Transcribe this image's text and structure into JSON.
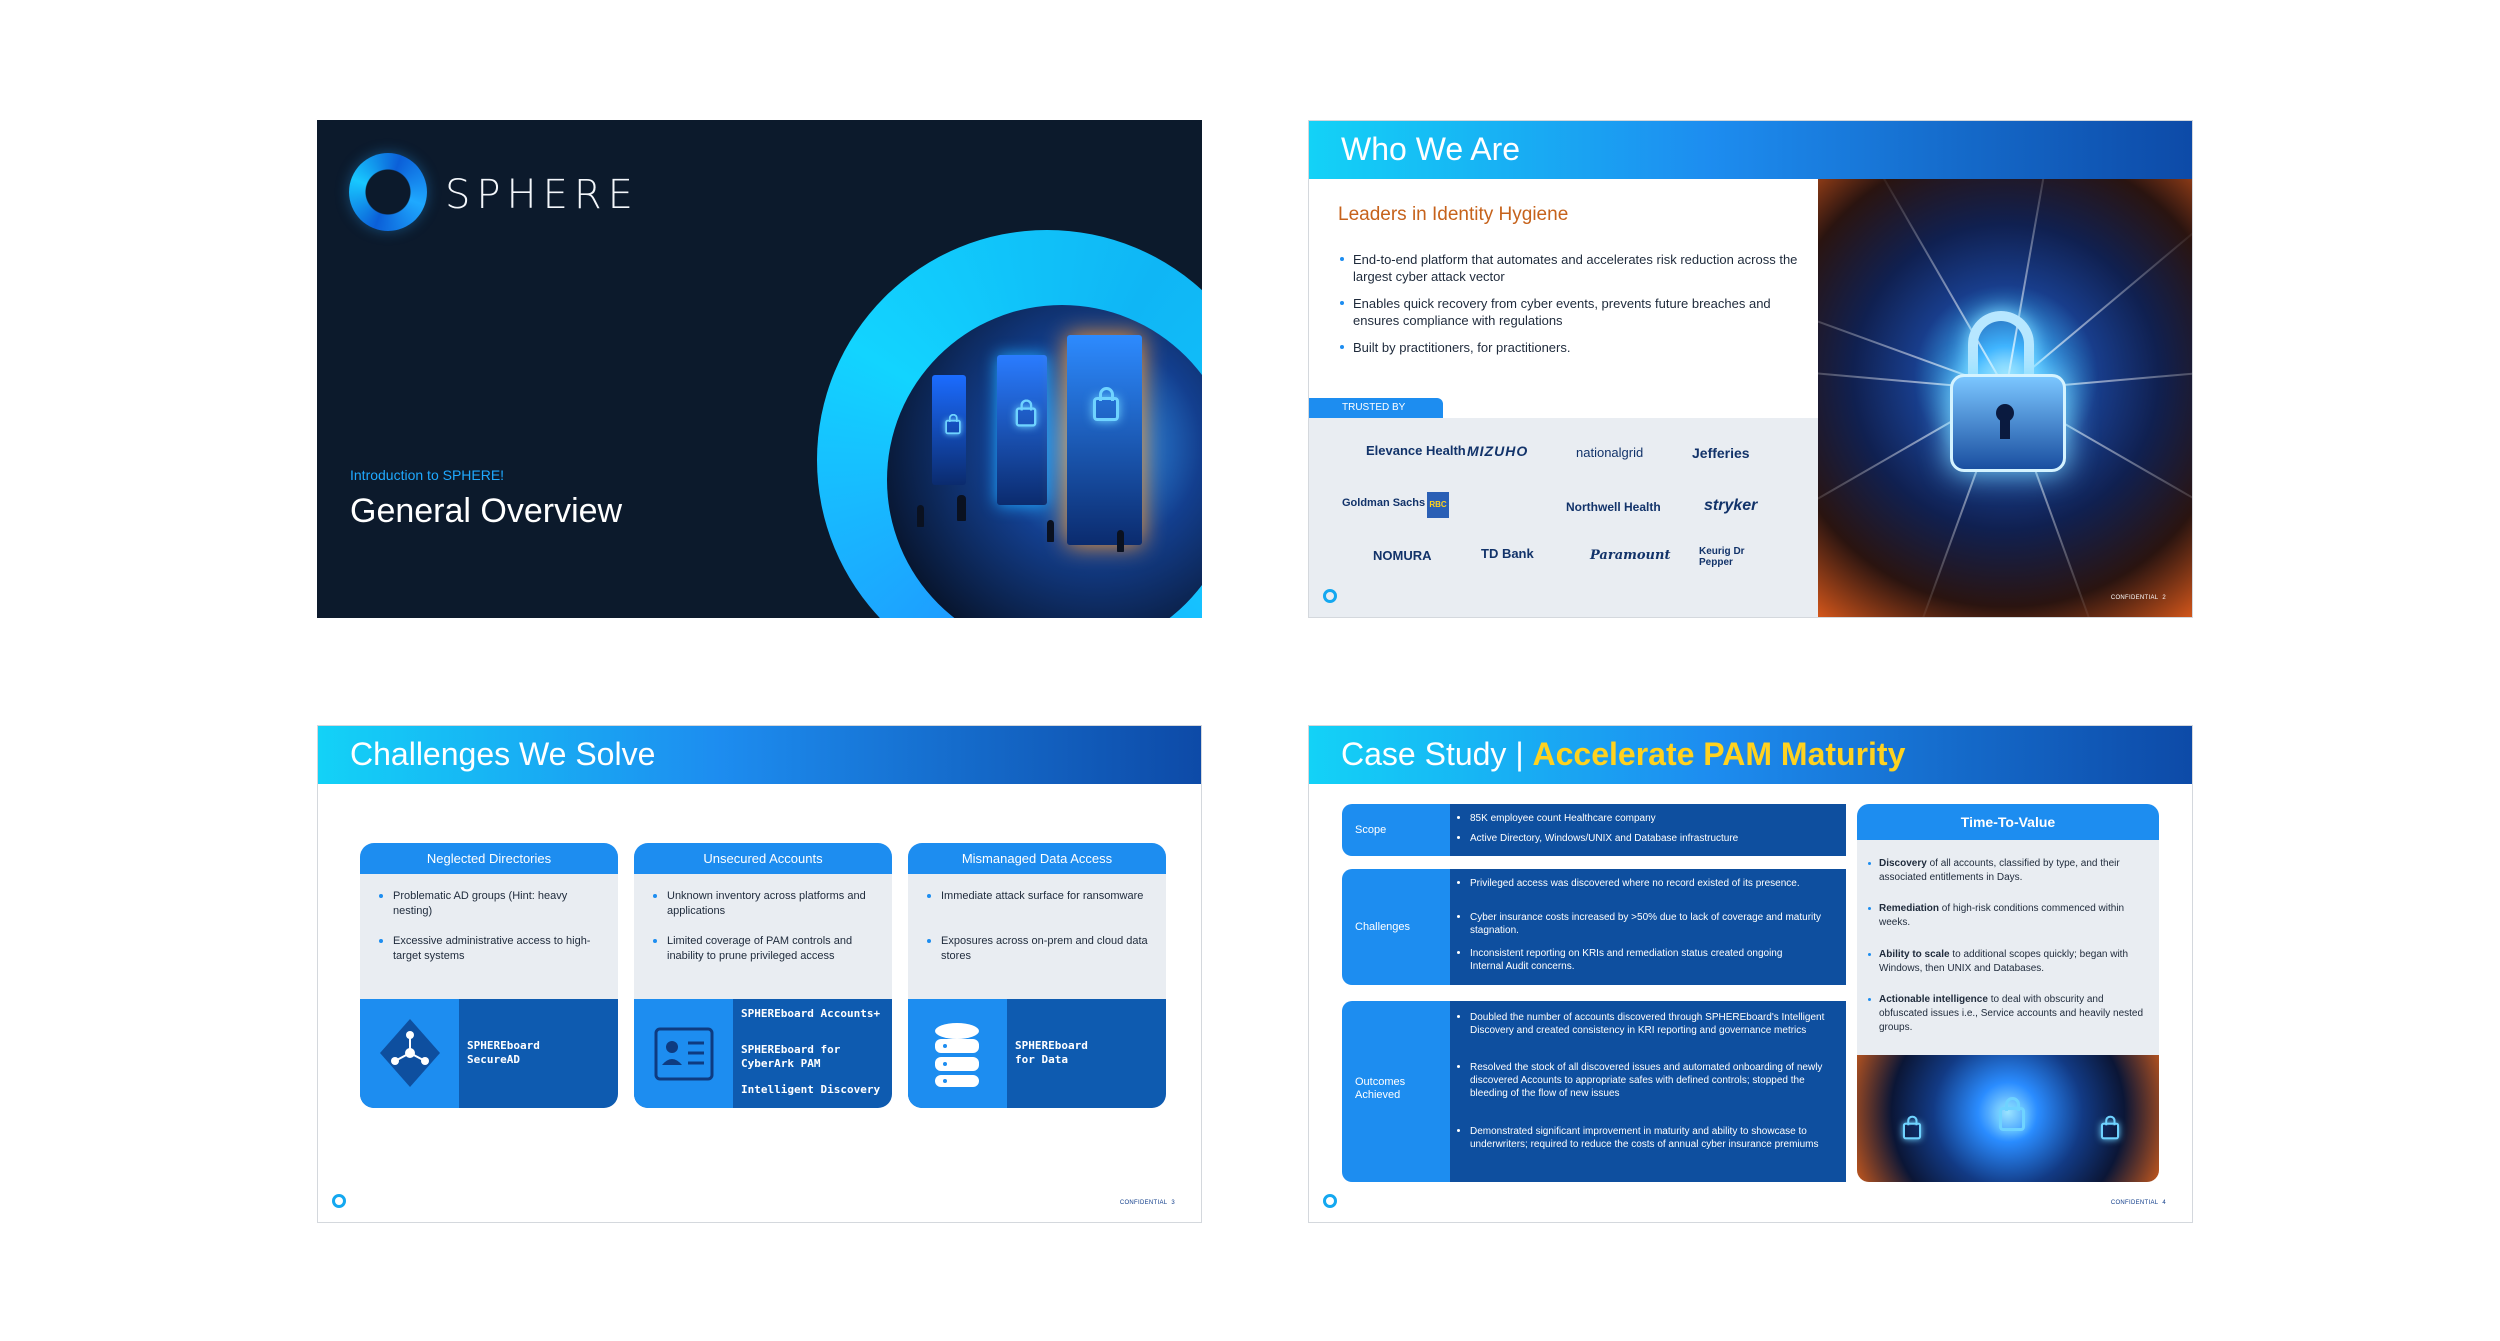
{
  "slide1": {
    "logo_text": "SPHERE",
    "kicker": "Introduction to SPHERE!",
    "title": "General Overview"
  },
  "slide2": {
    "title": "Who We Are",
    "subtitle": "Leaders in Identity Hygiene",
    "bullets": [
      "End-to-end platform that automates and accelerates risk reduction across the largest cyber attack vector",
      "Enables quick recovery from cyber events, prevents future breaches and ensures compliance with regulations",
      "Built by practitioners, for practitioners."
    ],
    "trusted_label": "TRUSTED BY",
    "logos": [
      "Elevance Health",
      "MIZUHO",
      "nationalgrid",
      "Jefferies",
      "Goldman Sachs",
      "RBC",
      "Northwell Health",
      "stryker",
      "NOMURA",
      "TD Bank",
      "Paramount",
      "Keurig Dr Pepper"
    ],
    "footer_conf": "CONFIDENTIAL",
    "page": "2"
  },
  "slide3": {
    "title": "Challenges We Solve",
    "cards": [
      {
        "header": "Neglected Directories",
        "bullets": [
          "Problematic AD groups (Hint: heavy nesting)",
          "Excessive administrative access to high-target systems"
        ],
        "products": [
          "SPHEREboard",
          "SecureAD"
        ]
      },
      {
        "header": "Unsecured Accounts",
        "bullets": [
          "Unknown inventory across platforms and applications",
          "Limited coverage of PAM controls and inability to prune privileged access"
        ],
        "products": [
          "SPHEREboard Accounts+",
          "SPHEREboard for CyberArk PAM",
          "Intelligent Discovery"
        ]
      },
      {
        "header": "Mismanaged Data Access",
        "bullets": [
          "Immediate attack surface for ransomware",
          "Exposures across on-prem and cloud data stores"
        ],
        "products": [
          "SPHEREboard",
          "for Data"
        ]
      }
    ],
    "footer_conf": "CONFIDENTIAL",
    "page": "3"
  },
  "slide4": {
    "title_plain": "Case Study | ",
    "title_accent": "Accelerate PAM Maturity",
    "rows": [
      {
        "label": "Scope",
        "items": [
          "85K employee count Healthcare company",
          "Active Directory, Windows/UNIX and Database infrastructure"
        ]
      },
      {
        "label": "Challenges",
        "items": [
          "Privileged access was discovered where no record existed of its presence.",
          "Cyber insurance costs increased by >50% due to lack of coverage and maturity stagnation.",
          "Inconsistent reporting on KRIs and remediation status created ongoing Internal Audit concerns."
        ]
      },
      {
        "label": "Outcomes Achieved",
        "items": [
          "Doubled the number of accounts discovered through SPHEREboard's Intelligent Discovery and created consistency in KRI reporting and governance metrics",
          "Resolved the stock of all discovered issues and automated onboarding of newly discovered Accounts to appropriate safes with defined controls; stopped the bleeding of the flow of new issues",
          "Demonstrated significant improvement in maturity and ability to showcase to underwriters; required to reduce the costs of annual cyber insurance premiums"
        ]
      }
    ],
    "ttv_title": "Time-To-Value",
    "ttv": [
      {
        "bold": "Discovery",
        "text": " of all accounts, classified by type, and their associated entitlements in Days."
      },
      {
        "bold": "Remediation",
        "text": " of high-risk conditions commenced within weeks."
      },
      {
        "bold": "Ability to scale",
        "text": " to additional scopes quickly; began with Windows, then UNIX and Databases."
      },
      {
        "bold": "Actionable intelligence",
        "text": " to deal with obscurity and obfuscated issues i.e., Service accounts and heavily nested groups."
      }
    ],
    "footer_conf": "CONFIDENTIAL",
    "page": "4"
  }
}
